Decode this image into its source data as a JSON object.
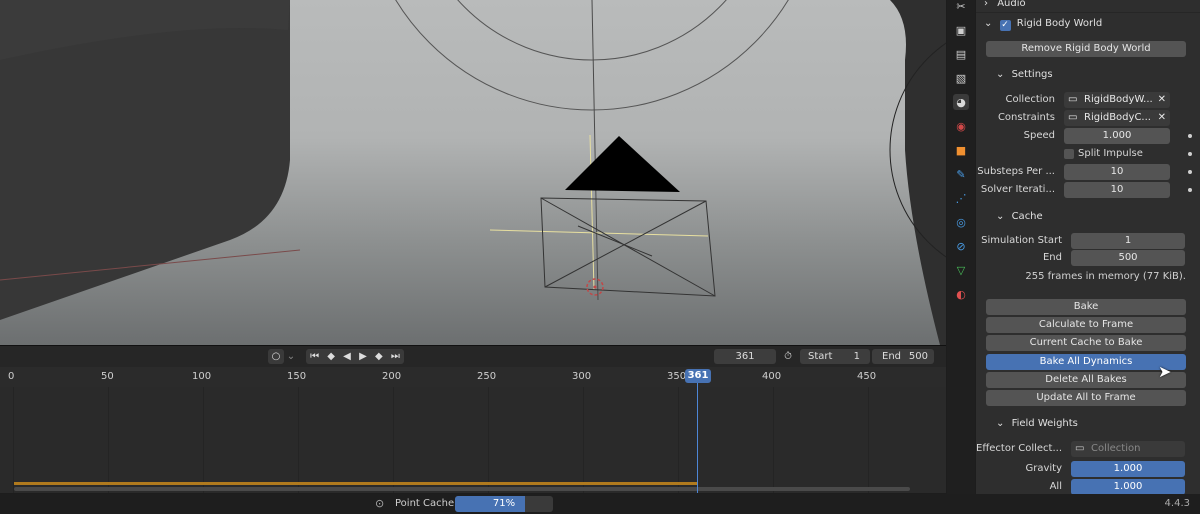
{
  "properties": {
    "audio_header": "Audio",
    "rigid_body_world_header": "Rigid Body World",
    "remove_button": "Remove Rigid Body World",
    "settings_header": "Settings",
    "collection_label": "Collection",
    "collection_value": "RigidBodyW...",
    "constraints_label": "Constraints",
    "constraints_value": "RigidBodyC...",
    "speed_label": "Speed",
    "speed_value": "1.000",
    "split_impulse_label": "Split Impulse",
    "substeps_label": "Substeps Per ...",
    "substeps_value": "10",
    "solver_label": "Solver Iterati...",
    "solver_value": "10",
    "cache_header": "Cache",
    "sim_start_label": "Simulation Start",
    "sim_start_value": "1",
    "end_label": "End",
    "end_value": "500",
    "cache_info": "255 frames in memory (77 KiB).",
    "bake_button": "Bake",
    "calc_frame_button": "Calculate to Frame",
    "current_cache_button": "Current Cache to Bake",
    "bake_all_button": "Bake All Dynamics",
    "delete_all_button": "Delete All Bakes",
    "update_all_button": "Update All to Frame",
    "field_weights_header": "Field Weights",
    "effector_label": "Effector Collect...",
    "effector_placeholder": "Collection",
    "gravity_label": "Gravity",
    "gravity_value": "1.000",
    "all_label": "All",
    "all_value": "1.000"
  },
  "timeline": {
    "current_frame": "361",
    "start_label": "Start",
    "start_value": "1",
    "end_label": "End",
    "end_value": "500",
    "ticks": [
      "0",
      "50",
      "100",
      "150",
      "200",
      "250",
      "300",
      "350",
      "400",
      "450"
    ],
    "playhead": "361"
  },
  "statusbar": {
    "task_label": "Point Cache",
    "progress_text": "71%",
    "progress_fraction": 0.71,
    "version": "4.4.3"
  },
  "tabs": [
    {
      "icon": "tool-icon",
      "color": "#cfcfcf"
    },
    {
      "icon": "render-icon",
      "color": "#cfcfcf"
    },
    {
      "icon": "output-icon",
      "color": "#cfcfcf"
    },
    {
      "icon": "view-layer-icon",
      "color": "#cfcfcf"
    },
    {
      "icon": "scene-icon",
      "color": "#d8d8d8"
    },
    {
      "icon": "world-icon",
      "color": "#d04848"
    },
    {
      "icon": "object-icon",
      "color": "#f09030"
    },
    {
      "icon": "modifier-icon",
      "color": "#4a9ee8"
    },
    {
      "icon": "particles-icon",
      "color": "#4a9ee8"
    },
    {
      "icon": "physics-icon",
      "color": "#4a9ee8"
    },
    {
      "icon": "constraints-icon",
      "color": "#4a9ee8"
    },
    {
      "icon": "data-icon",
      "color": "#4ac05a"
    },
    {
      "icon": "material-icon",
      "color": "#e05050"
    }
  ],
  "colors": {
    "accent": "#4772b3",
    "cache_bar": "#b07a1e"
  }
}
